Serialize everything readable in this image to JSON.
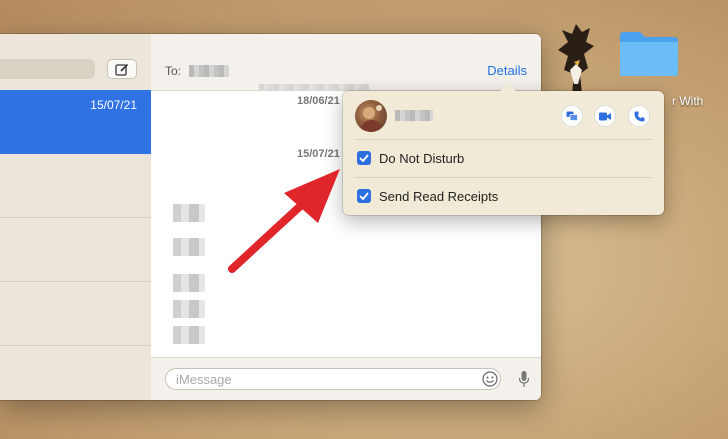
{
  "desktop": {
    "folder_label": "r With",
    "folder_color": "#5aaef3"
  },
  "sidebar": {
    "conversations": [
      {
        "date": "15/07/21",
        "selected": true
      }
    ]
  },
  "chat": {
    "to_label": "To:",
    "details_label": "Details",
    "timestamps": [
      "18/06/21",
      "15/07/21"
    ],
    "input_placeholder": "iMessage"
  },
  "popover": {
    "options": [
      {
        "label": "Do Not Disturb",
        "checked": true
      },
      {
        "label": "Send Read Receipts",
        "checked": true
      }
    ]
  },
  "colors": {
    "accent": "#2e6fe0",
    "annotation_arrow": "#e0262b"
  }
}
